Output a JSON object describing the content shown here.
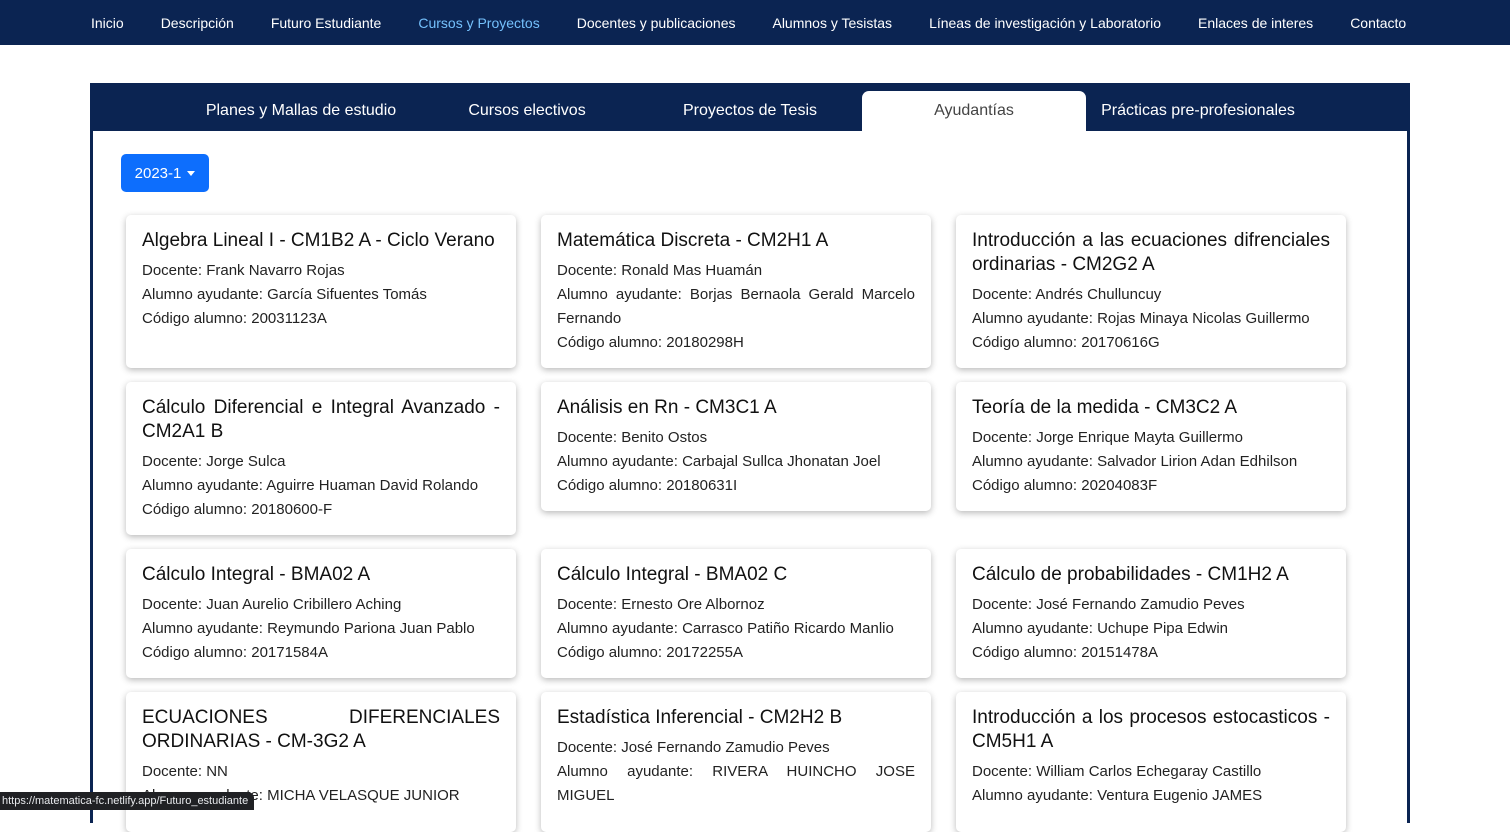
{
  "nav": {
    "items": [
      "Inicio",
      "Descripción",
      "Futuro Estudiante",
      "Cursos y Proyectos",
      "Docentes y publicaciones",
      "Alumnos y Tesistas",
      "Líneas de investigación y Laboratorio",
      "Enlaces de interes",
      "Contacto"
    ],
    "active": "Cursos y Proyectos"
  },
  "tabs": {
    "items": [
      "Planes y Mallas de estudio",
      "Cursos electivos",
      "Proyectos de Tesis",
      "Ayudantías",
      "Prácticas pre-profesionales"
    ],
    "active": "Ayudantías"
  },
  "semester": {
    "label": "2023-1"
  },
  "cards": [
    {
      "title": "Algebra Lineal I - CM1B2 A - Ciclo Verano",
      "lines": [
        "Docente: Frank Navarro Rojas",
        "Alumno ayudante: García Sifuentes Tomás",
        "Código alumno: 20031123A"
      ]
    },
    {
      "title": "Matemática Discreta - CM2H1 A",
      "lines": [
        "Docente: Ronald Mas Huamán",
        "Alumno ayudante: Borjas Bernaola Gerald Marcelo Fernando",
        "Código alumno: 20180298H"
      ]
    },
    {
      "title": "Introducción a las ecuaciones difrenciales ordinarias - CM2G2 A",
      "lines": [
        "Docente: Andrés Chulluncuy",
        "Alumno ayudante: Rojas Minaya Nicolas Guillermo",
        "Código alumno: 20170616G"
      ]
    },
    {
      "title": "Cálculo Diferencial e Integral Avanzado - CM2A1 B",
      "lines": [
        "Docente: Jorge Sulca",
        "Alumno ayudante: Aguirre Huaman David Rolando",
        "Código alumno: 20180600-F"
      ]
    },
    {
      "title": "Análisis en Rn - CM3C1 A",
      "lines": [
        "Docente: Benito Ostos",
        "Alumno ayudante: Carbajal Sullca Jhonatan Joel",
        "Código alumno: 20180631I"
      ]
    },
    {
      "title": "Teoría de la medida - CM3C2 A",
      "lines": [
        "Docente: Jorge Enrique Mayta Guillermo",
        "Alumno ayudante: Salvador Lirion Adan Edhilson",
        "Código alumno: 20204083F"
      ]
    },
    {
      "title": "Cálculo Integral - BMA02 A",
      "lines": [
        "Docente: Juan Aurelio Cribillero Aching",
        "Alumno ayudante: Reymundo Pariona Juan Pablo",
        "Código alumno: 20171584A"
      ]
    },
    {
      "title": "Cálculo Integral - BMA02 C",
      "lines": [
        "Docente: Ernesto Ore Albornoz",
        "Alumno ayudante: Carrasco Patiño Ricardo Manlio",
        "Código alumno: 20172255A"
      ]
    },
    {
      "title": "Cálculo de probabilidades - CM1H2 A",
      "lines": [
        "Docente: José Fernando Zamudio Peves",
        "Alumno ayudante: Uchupe Pipa Edwin",
        "Código alumno: 20151478A"
      ]
    },
    {
      "title": "ECUACIONES DIFERENCIALES ORDINARIAS - CM-3G2 A",
      "lines": [
        "Docente: NN",
        "Alumno ayudante: MICHA VELASQUE JUNIOR"
      ]
    },
    {
      "title": "Estadística Inferencial - CM2H2 B",
      "lines": [
        "Docente: José Fernando Zamudio Peves",
        "Alumno ayudante: RIVERA HUINCHO JOSE MIGUEL"
      ]
    },
    {
      "title": "Introducción a los procesos estocasticos - CM5H1 A",
      "lines": [
        "Docente: William Carlos Echegaray Castillo",
        "Alumno ayudante: Ventura Eugenio JAMES"
      ]
    }
  ],
  "status_url": "https://matematica-fc.netlify.app/Futuro_estudiante"
}
